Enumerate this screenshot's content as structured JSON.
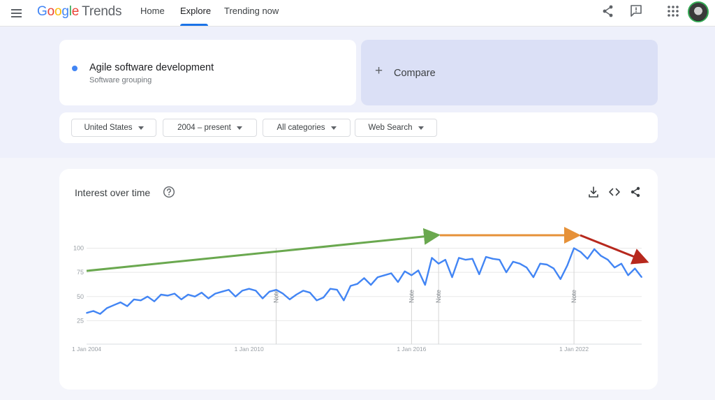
{
  "header": {
    "logo": {
      "google": [
        "G",
        "o",
        "o",
        "g",
        "l",
        "e"
      ],
      "trends": "Trends"
    },
    "nav": [
      "Home",
      "Explore",
      "Trending now"
    ],
    "active_tab": "Explore",
    "icons": [
      "menu-icon",
      "share-icon",
      "feedback-icon",
      "apps-icon",
      "avatar"
    ]
  },
  "search_term": {
    "title": "Agile software development",
    "subtitle": "Software grouping",
    "color": "#4285f4"
  },
  "compare": {
    "plus": "+",
    "label": "Compare"
  },
  "filters": [
    {
      "label": "United States"
    },
    {
      "label": "2004 – present"
    },
    {
      "label": "All categories"
    },
    {
      "label": "Web Search"
    }
  ],
  "interest_over_time": {
    "title": "Interest over time",
    "icons": [
      "help-icon",
      "download-icon",
      "embed-icon",
      "share-icon"
    ]
  },
  "chart_data": {
    "type": "line",
    "title": "",
    "xlabel": "",
    "ylabel": "",
    "ylim": [
      0,
      100
    ],
    "yticks": [
      25,
      50,
      75,
      100
    ],
    "xticks": [
      {
        "t": 2004.0,
        "label": "1 Jan 2004"
      },
      {
        "t": 2010.0,
        "label": "1 Jan 2010"
      },
      {
        "t": 2016.0,
        "label": "1 Jan 2016"
      },
      {
        "t": 2022.0,
        "label": "1 Jan 2022"
      }
    ],
    "x_range": [
      2004.0,
      2024.5
    ],
    "notes": [
      {
        "t": 2011.0,
        "label": "Note"
      },
      {
        "t": 2016.0,
        "label": "Note"
      },
      {
        "t": 2017.0,
        "label": "Note"
      },
      {
        "t": 2022.0,
        "label": "Note"
      }
    ],
    "series": [
      {
        "color": "#4285f4",
        "x": [
          2004.0,
          2004.25,
          2004.5,
          2004.75,
          2005.0,
          2005.25,
          2005.5,
          2005.75,
          2006.0,
          2006.25,
          2006.5,
          2006.75,
          2007.0,
          2007.25,
          2007.5,
          2007.75,
          2008.0,
          2008.25,
          2008.5,
          2008.75,
          2009.0,
          2009.25,
          2009.5,
          2009.75,
          2010.0,
          2010.25,
          2010.5,
          2010.75,
          2011.0,
          2011.25,
          2011.5,
          2011.75,
          2012.0,
          2012.25,
          2012.5,
          2012.75,
          2013.0,
          2013.25,
          2013.5,
          2013.75,
          2014.0,
          2014.25,
          2014.5,
          2014.75,
          2015.0,
          2015.25,
          2015.5,
          2015.75,
          2016.0,
          2016.25,
          2016.5,
          2016.75,
          2017.0,
          2017.25,
          2017.5,
          2017.75,
          2018.0,
          2018.25,
          2018.5,
          2018.75,
          2019.0,
          2019.25,
          2019.5,
          2019.75,
          2020.0,
          2020.25,
          2020.5,
          2020.75,
          2021.0,
          2021.25,
          2021.5,
          2021.75,
          2022.0,
          2022.25,
          2022.5,
          2022.75,
          2023.0,
          2023.25,
          2023.5,
          2023.75,
          2024.0,
          2024.25,
          2024.5
        ],
        "y": [
          33,
          35,
          32,
          38,
          41,
          44,
          40,
          47,
          46,
          50,
          45,
          52,
          51,
          53,
          47,
          52,
          50,
          54,
          48,
          53,
          55,
          57,
          50,
          56,
          58,
          56,
          48,
          55,
          57,
          53,
          47,
          52,
          56,
          54,
          46,
          49,
          58,
          57,
          46,
          61,
          63,
          69,
          62,
          70,
          72,
          74,
          65,
          76,
          72,
          77,
          62,
          90,
          84,
          88,
          70,
          90,
          88,
          89,
          73,
          91,
          89,
          88,
          75,
          86,
          84,
          80,
          70,
          84,
          83,
          79,
          68,
          82,
          100,
          96,
          89,
          99,
          92,
          88,
          80,
          84,
          72,
          79,
          70
        ]
      }
    ]
  }
}
